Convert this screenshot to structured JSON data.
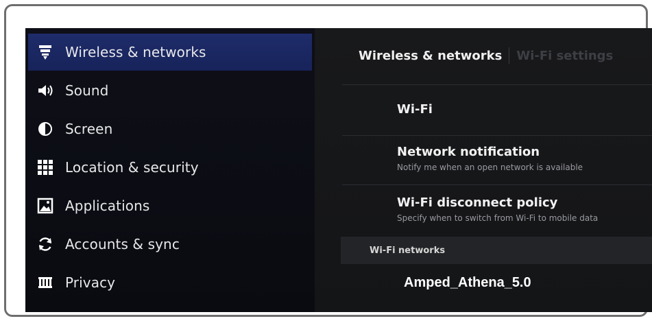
{
  "sidebar": {
    "items": [
      {
        "label": "Wireless & networks",
        "icon": "wifi-icon",
        "selected": true
      },
      {
        "label": "Sound",
        "icon": "speaker-icon",
        "selected": false
      },
      {
        "label": "Screen",
        "icon": "brightness-icon",
        "selected": false
      },
      {
        "label": "Location & security",
        "icon": "grid-icon",
        "selected": false
      },
      {
        "label": "Applications",
        "icon": "picture-icon",
        "selected": false
      },
      {
        "label": "Accounts & sync",
        "icon": "sync-icon",
        "selected": false
      },
      {
        "label": "Privacy",
        "icon": "privacy-icon",
        "selected": false
      }
    ]
  },
  "main": {
    "breadcrumb": {
      "title": "Wireless & networks",
      "subtitle": "Wi-Fi settings"
    },
    "prefs": [
      {
        "title": "Wi-Fi",
        "summary": ""
      },
      {
        "title": "Network notification",
        "summary": "Notify me when an open network is available"
      },
      {
        "title": "Wi-Fi disconnect policy",
        "summary": "Specify when to switch from Wi-Fi to mobile data"
      }
    ],
    "section_header": "Wi-Fi networks",
    "network_name": "Amped_Athena_5.0"
  },
  "colors": {
    "selected_bg": "#1e2c6a",
    "panel_bg": "#18191b",
    "text": "#f2f2f2",
    "summary_text": "#9a9aa0"
  }
}
